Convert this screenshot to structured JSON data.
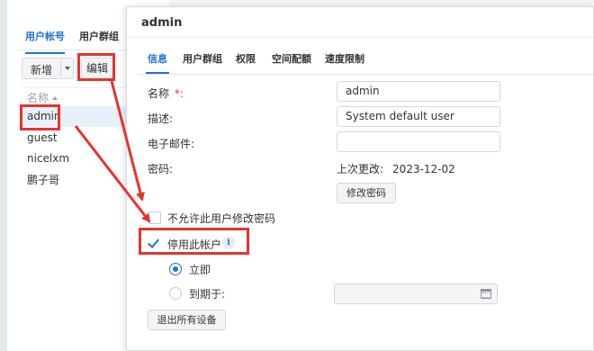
{
  "background": {
    "tabs": [
      {
        "label": "用户帐号",
        "active": true
      },
      {
        "label": "用户群组",
        "active": false
      }
    ],
    "toolbar": {
      "add_label": "新增",
      "edit_label": "编辑"
    },
    "list_header": {
      "name_label": "名称"
    },
    "users": [
      "admin",
      "guest",
      "nicelxm",
      "鹏子哥"
    ],
    "selected_user": "admin"
  },
  "dialog": {
    "title": "admin",
    "tabs": [
      {
        "label": "信息",
        "active": true
      },
      {
        "label": "用户群组",
        "active": false
      },
      {
        "label": "权限",
        "active": false
      },
      {
        "label": "空间配额",
        "active": false
      },
      {
        "label": "速度限制",
        "active": false
      }
    ],
    "form": {
      "name_label": "名称",
      "required_mark": "*:",
      "name_value": "admin",
      "description_label": "描述:",
      "description_value": "System default user",
      "email_label": "电子邮件:",
      "email_value": "",
      "password_label": "密码:",
      "last_changed_label": "上次更改:",
      "last_changed_value": "2023-12-02",
      "change_password_button": "修改密码",
      "disallow_change_password_label": "不允许此用户修改密码",
      "disallow_change_password_checked": false,
      "disable_account_label": "停用此帐户",
      "disable_account_checked": true,
      "info_icon_glyph": "i",
      "option_immediately_label": "立即",
      "option_immediately_selected": true,
      "option_until_label": "到期于:",
      "option_until_selected": false,
      "expiry_date_value": "",
      "logout_all_devices_button": "退出所有设备"
    }
  },
  "colors": {
    "accent": "#1a73d9",
    "highlight": "#e8322e",
    "required": "#e03b3b"
  }
}
